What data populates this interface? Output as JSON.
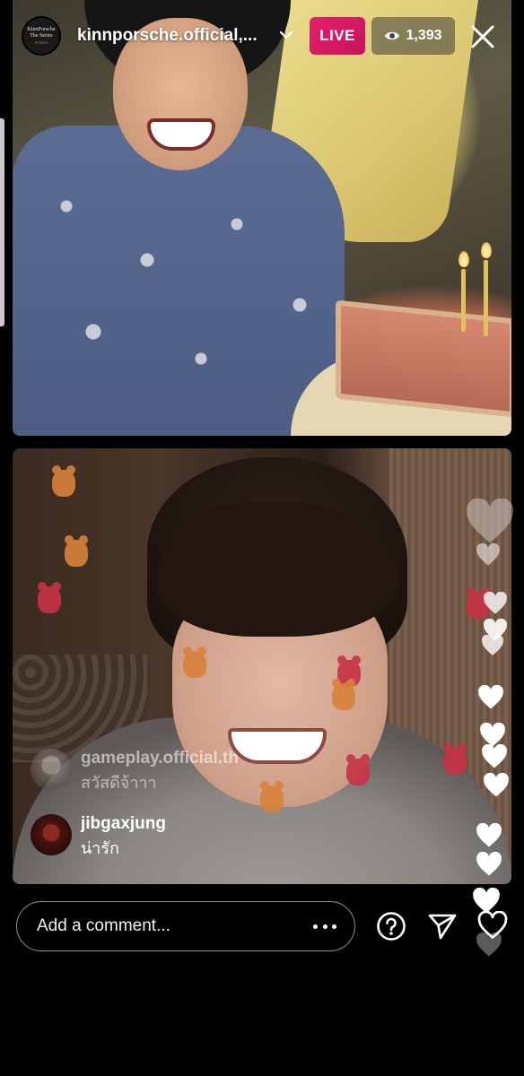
{
  "header": {
    "host_username": "kinnporsche.official,...",
    "host_avatar_lines": [
      "KinnPorsche",
      "The Series"
    ],
    "host_avatar_tag": "WORLD",
    "live_label": "LIVE",
    "viewer_count": "1,393",
    "icons": [
      "chevron-down-icon",
      "eye-icon",
      "close-icon"
    ]
  },
  "comments": [
    {
      "username": "gameplay.official.th",
      "text": "สวัสดีจ้าาา"
    },
    {
      "username": "jibgaxjung",
      "text": "น่ารัก"
    }
  ],
  "composer": {
    "placeholder": "Add a comment...",
    "icons": [
      "more-icon",
      "question-icon",
      "send-icon",
      "heart-icon"
    ]
  },
  "colors": {
    "live_badge": "#d81b60",
    "background": "#000000",
    "text": "#ffffff"
  }
}
